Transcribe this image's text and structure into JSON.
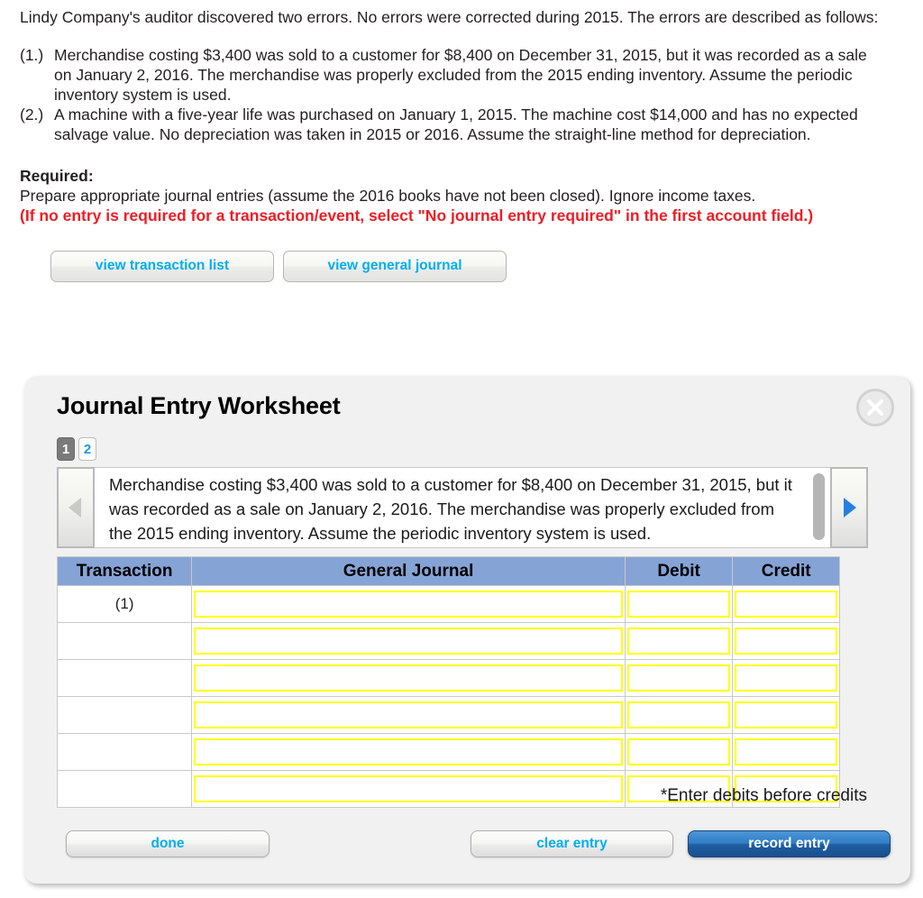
{
  "problem": {
    "intro": "Lindy Company's auditor discovered two errors. No errors were corrected during 2015. The errors are described as follows:",
    "items": [
      {
        "num": "(1.)",
        "text": "Merchandise costing $3,400 was sold to a customer for $8,400 on December 31, 2015, but it was recorded as a sale on January 2, 2016. The merchandise was properly excluded from the 2015 ending inventory. Assume the periodic inventory system is used."
      },
      {
        "num": "(2.)",
        "text": "A machine with a five-year life was purchased on January 1, 2015. The machine cost $14,000 and has no expected salvage value. No depreciation was taken in 2015 or 2016. Assume the straight-line method for depreciation."
      }
    ],
    "required_label": "Required:",
    "required_text": "Prepare appropriate journal entries (assume the 2016 books have not been closed). Ignore income taxes.",
    "required_note": "(If no entry is required for a transaction/event, select \"No journal entry required\" in the first account field.)"
  },
  "view_buttons": {
    "transaction_list": "view transaction list",
    "general_journal": "view general journal"
  },
  "worksheet": {
    "title": "Journal Entry Worksheet",
    "close_label": "X",
    "tabs": [
      {
        "label": "1",
        "active": true
      },
      {
        "label": "2",
        "active": false
      }
    ],
    "description": "Merchandise costing $3,400 was sold to a customer for $8,400 on December 31, 2015, but it was recorded as a sale on January 2, 2016. The merchandise was properly excluded from the 2015 ending inventory. Assume the periodic inventory system is used.",
    "prev_arrow_enabled": false,
    "next_arrow_enabled": true,
    "table": {
      "headers": [
        "Transaction",
        "General Journal",
        "Debit",
        "Credit"
      ],
      "rows": [
        {
          "transaction": "(1)",
          "general_journal": "",
          "debit": "",
          "credit": ""
        },
        {
          "transaction": "",
          "general_journal": "",
          "debit": "",
          "credit": ""
        },
        {
          "transaction": "",
          "general_journal": "",
          "debit": "",
          "credit": ""
        },
        {
          "transaction": "",
          "general_journal": "",
          "debit": "",
          "credit": ""
        },
        {
          "transaction": "",
          "general_journal": "",
          "debit": "",
          "credit": ""
        },
        {
          "transaction": "",
          "general_journal": "",
          "debit": "",
          "credit": ""
        }
      ]
    },
    "note_credits": "*Enter debits before credits",
    "buttons": {
      "done": "done",
      "clear_entry": "clear entry",
      "record_entry": "record entry"
    }
  },
  "colors": {
    "link_blue": "#00aeef",
    "required_red": "#ee1c25",
    "table_header_blue": "#86a3d6",
    "input_border_yellow": "#ffff00",
    "record_button_blue": "#2f7dc4",
    "tab_active_grey": "#7a7a7a"
  }
}
